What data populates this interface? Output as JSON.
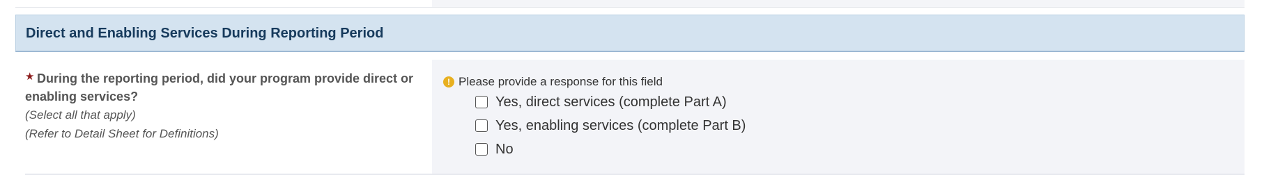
{
  "section": {
    "title": "Direct and Enabling Services During Reporting Period"
  },
  "question": {
    "required_marker": "★",
    "text_line1": "During the reporting period, did your program provide direct or",
    "text_line2": "enabling services?",
    "hint1": "(Select all that apply)",
    "hint2": "(Refer to Detail Sheet for Definitions)",
    "validation_icon": "exclamation-circle-icon",
    "validation_message": "Please provide a response for this field",
    "options": [
      {
        "label": "Yes, direct services (complete Part A)",
        "checked": false
      },
      {
        "label": "Yes, enabling services (complete Part B)",
        "checked": false
      },
      {
        "label": "No",
        "checked": false
      }
    ]
  },
  "colors": {
    "header_bg": "#d4e3f0",
    "header_text": "#163a5c",
    "required_star": "#8b1a1a",
    "warning": "#e8b020",
    "answer_bg": "#f3f4f8"
  }
}
